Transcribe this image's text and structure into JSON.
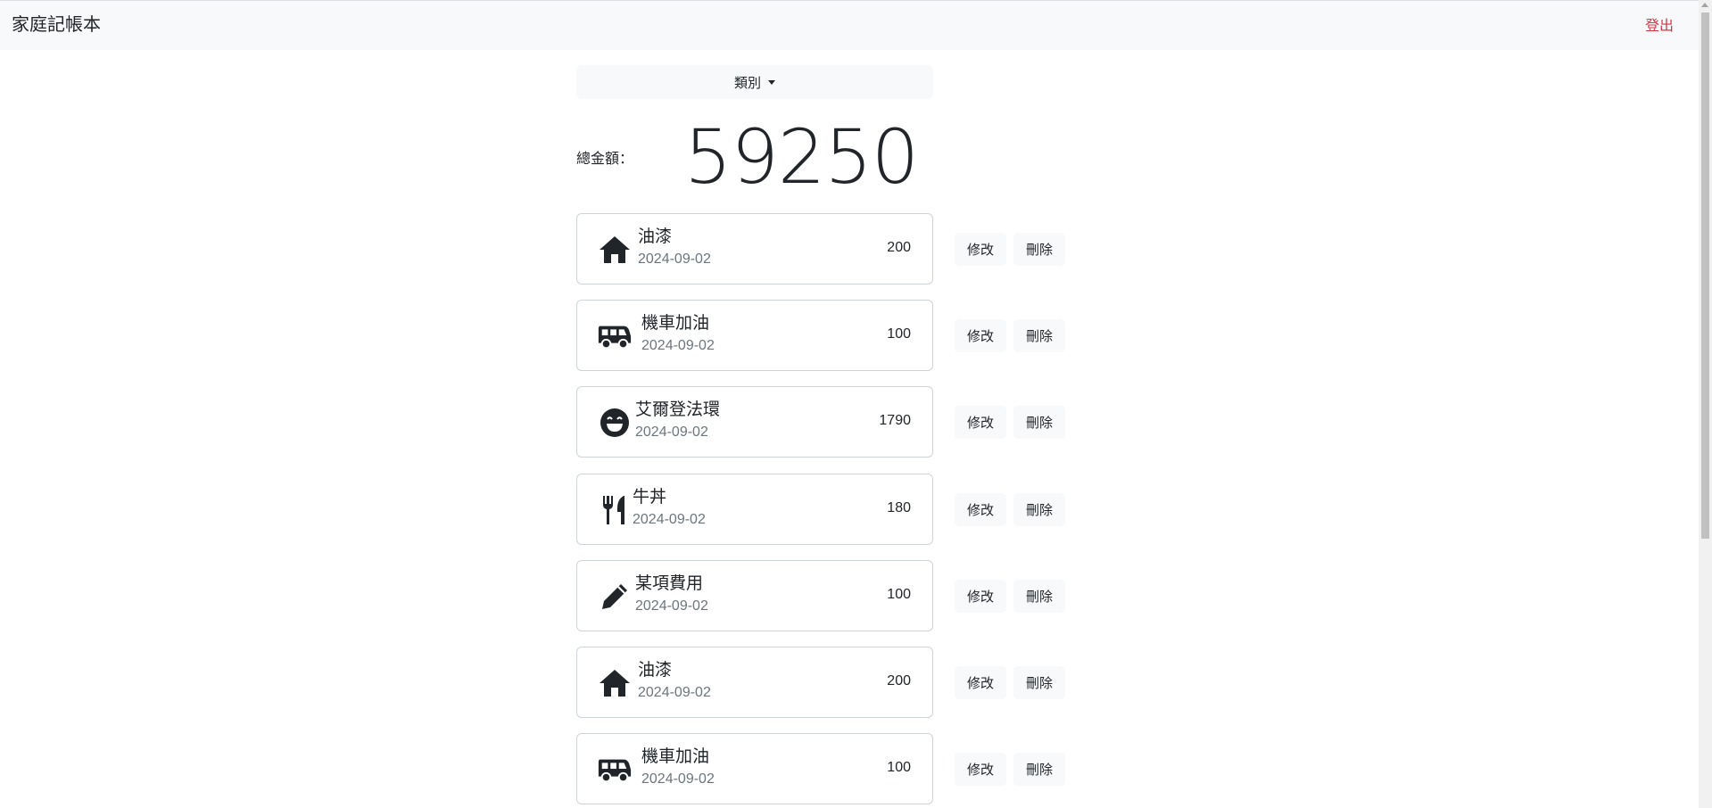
{
  "navbar": {
    "brand": "家庭記帳本",
    "logout": "登出"
  },
  "filter": {
    "label": "類別"
  },
  "summary": {
    "label": "總金額：",
    "total": "59250"
  },
  "actions": {
    "edit": "修改",
    "delete": "刪除"
  },
  "records": [
    {
      "icon": "house-icon",
      "name": "油漆",
      "date": "2024-09-02",
      "amount": "200"
    },
    {
      "icon": "van-icon",
      "name": "機車加油",
      "date": "2024-09-02",
      "amount": "100"
    },
    {
      "icon": "smile-icon",
      "name": "艾爾登法環",
      "date": "2024-09-02",
      "amount": "1790"
    },
    {
      "icon": "utensils-icon",
      "name": "牛丼",
      "date": "2024-09-02",
      "amount": "180"
    },
    {
      "icon": "pen-icon",
      "name": "某項費用",
      "date": "2024-09-02",
      "amount": "100"
    },
    {
      "icon": "house-icon",
      "name": "油漆",
      "date": "2024-09-02",
      "amount": "200"
    },
    {
      "icon": "van-icon",
      "name": "機車加油",
      "date": "2024-09-02",
      "amount": "100"
    }
  ]
}
